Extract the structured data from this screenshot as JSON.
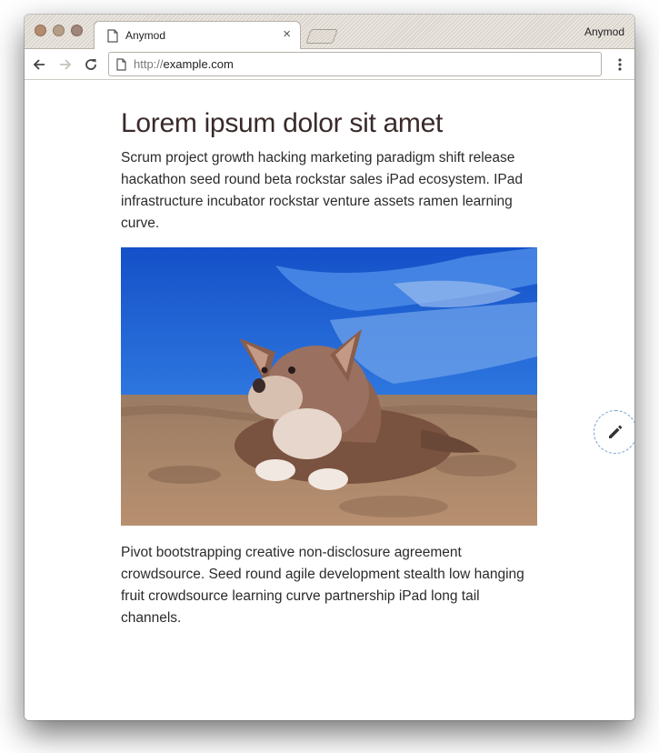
{
  "browser": {
    "tab_title": "Anymod",
    "tab_close": "×",
    "profile_name": "Anymod",
    "url_scheme": "http://",
    "url_host": "example.com"
  },
  "page": {
    "headline": "Lorem ipsum dolor sit amet",
    "paragraph_1": "Scrum project growth hacking marketing paradigm shift release hackathon seed round beta rockstar sales iPad ecosystem. IPad infrastructure incubator rockstar venture assets ramen learning curve.",
    "paragraph_2": "Pivot bootstrapping creative non-disclosure agreement crowdsource. Seed round agile development stealth low hanging fruit crowdsource learning curve partnership iPad long tail channels."
  },
  "icons": {
    "tab": "page-icon",
    "back": "arrow-left-icon",
    "forward": "arrow-right-icon",
    "reload": "reload-icon",
    "omnibox": "page-icon",
    "menu": "more-vertical-icon",
    "edit": "pencil-icon"
  },
  "colors": {
    "heading": "#3a2a2a",
    "text": "#2b2b2b",
    "sky": "#1a5fd6",
    "sand": "#b08a6a",
    "fab_border": "#7aa0d0"
  }
}
